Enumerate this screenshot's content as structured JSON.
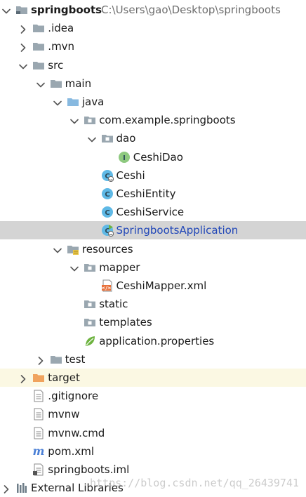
{
  "project": {
    "name": "springboots",
    "path": "C:\\Users\\gao\\Desktop\\springboots"
  },
  "tree": [
    {
      "label": "springboots",
      "depth": 0,
      "expanded": true,
      "icon": "project-folder-icon",
      "bold": true
    },
    {
      "label": ".idea",
      "depth": 1,
      "expanded": false,
      "icon": "folder-icon"
    },
    {
      "label": ".mvn",
      "depth": 1,
      "expanded": false,
      "icon": "folder-icon"
    },
    {
      "label": "src",
      "depth": 1,
      "expanded": true,
      "icon": "folder-icon"
    },
    {
      "label": "main",
      "depth": 2,
      "expanded": true,
      "icon": "folder-icon"
    },
    {
      "label": "java",
      "depth": 3,
      "expanded": true,
      "icon": "source-folder-icon"
    },
    {
      "label": "com.example.springboots",
      "depth": 4,
      "expanded": true,
      "icon": "package-icon"
    },
    {
      "label": "dao",
      "depth": 5,
      "expanded": true,
      "icon": "package-icon"
    },
    {
      "label": "CeshiDao",
      "depth": 6,
      "icon": "interface-icon"
    },
    {
      "label": "Ceshi",
      "depth": 5,
      "icon": "spring-class-icon"
    },
    {
      "label": "CeshiEntity",
      "depth": 5,
      "icon": "class-icon"
    },
    {
      "label": "CeshiService",
      "depth": 5,
      "icon": "class-icon"
    },
    {
      "label": "SpringbootsApplication",
      "depth": 5,
      "icon": "spring-boot-class-icon",
      "selected": true
    },
    {
      "label": "resources",
      "depth": 3,
      "expanded": true,
      "icon": "resources-folder-icon"
    },
    {
      "label": "mapper",
      "depth": 4,
      "expanded": true,
      "icon": "package-icon"
    },
    {
      "label": "CeshiMapper.xml",
      "depth": 5,
      "icon": "xml-file-icon"
    },
    {
      "label": "static",
      "depth": 4,
      "icon": "package-icon"
    },
    {
      "label": "templates",
      "depth": 4,
      "icon": "package-icon"
    },
    {
      "label": "application.properties",
      "depth": 4,
      "icon": "spring-properties-icon"
    },
    {
      "label": "test",
      "depth": 2,
      "expanded": false,
      "icon": "folder-icon"
    },
    {
      "label": "target",
      "depth": 1,
      "expanded": false,
      "icon": "excluded-folder-icon",
      "excluded": true
    },
    {
      "label": ".gitignore",
      "depth": 1,
      "icon": "text-file-icon"
    },
    {
      "label": "mvnw",
      "depth": 1,
      "icon": "text-file-icon"
    },
    {
      "label": "mvnw.cmd",
      "depth": 1,
      "icon": "text-file-icon"
    },
    {
      "label": "pom.xml",
      "depth": 1,
      "icon": "maven-icon"
    },
    {
      "label": "springboots.iml",
      "depth": 1,
      "icon": "iml-file-icon"
    },
    {
      "label": "External Libraries",
      "depth": 0,
      "expanded": false,
      "icon": "libraries-icon"
    }
  ],
  "watermark": "https://blog.csdn.net/qq_26439741",
  "colors": {
    "selection": "#d4d4d4",
    "excluded": "#fbf8e3",
    "selected_text": "#2147b8",
    "folder": "#9aa7b0",
    "source_folder": "#87b9e0",
    "excluded_folder": "#f0a35e",
    "class_icon": "#5fb9e6",
    "interface_icon": "#8ec97f",
    "spring": "#6db33f",
    "xml": "#e8703a"
  }
}
